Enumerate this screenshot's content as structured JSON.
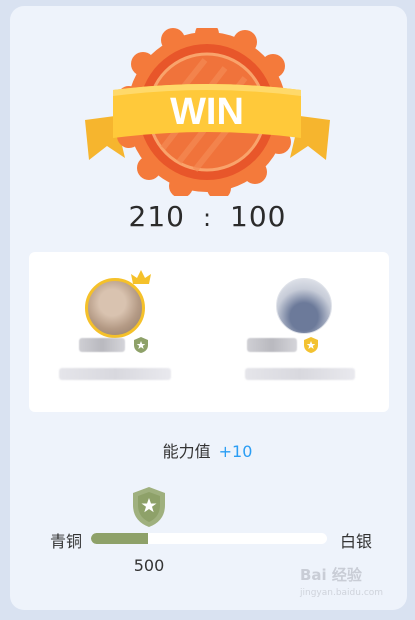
{
  "result": {
    "label": "WIN"
  },
  "score": {
    "left": "210",
    "separator": ":",
    "right": "100"
  },
  "ability": {
    "label": "能力值",
    "delta": "+10"
  },
  "tiers": {
    "current": "青铜",
    "next": "白银"
  },
  "progress": {
    "points": "500",
    "fraction": 0.24
  },
  "watermark": {
    "text": "Bai 经验",
    "sub": "jingyan.baidu.com"
  },
  "colors": {
    "accent": "#2a9df4",
    "progress": "#8ea169",
    "badge_orange": "#f26a2e",
    "ribbon": "#ffc93a"
  },
  "icons": {
    "left_rank": "green-shield-star-icon",
    "right_rank": "gold-shield-star-icon",
    "marker": "green-shield-star-icon",
    "crown": "crown-icon"
  }
}
